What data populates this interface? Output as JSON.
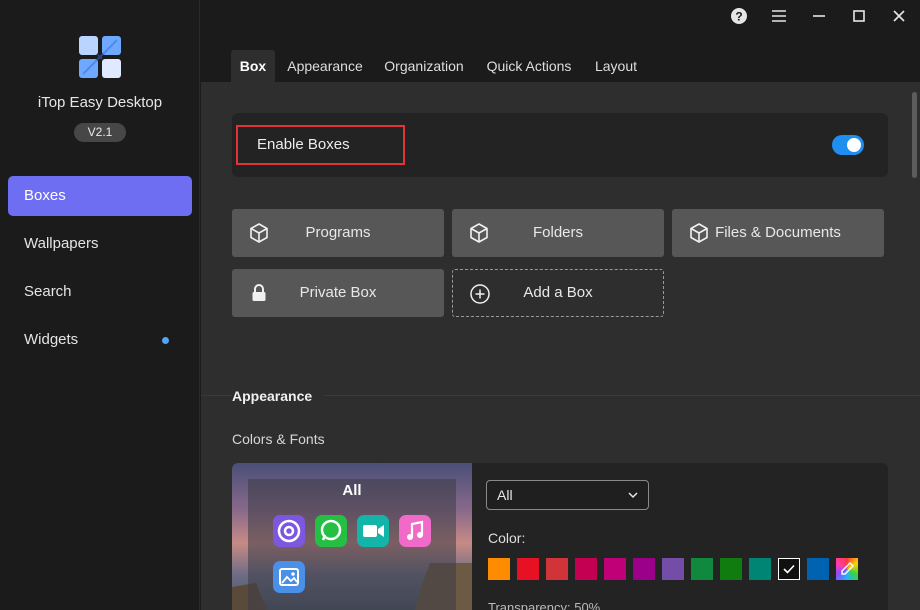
{
  "app": {
    "name": "iTop Easy Desktop",
    "version": "V2.1"
  },
  "sidebar": {
    "items": [
      {
        "label": "Boxes",
        "active": true
      },
      {
        "label": "Wallpapers",
        "active": false
      },
      {
        "label": "Search",
        "active": false
      },
      {
        "label": "Widgets",
        "active": false,
        "dot": true
      }
    ]
  },
  "window_controls": [
    "help-icon",
    "menu-icon",
    "minimize-icon",
    "maximize-icon",
    "close-icon"
  ],
  "tabs": [
    {
      "label": "Box",
      "active": true
    },
    {
      "label": "Appearance",
      "active": false
    },
    {
      "label": "Organization",
      "active": false
    },
    {
      "label": "Quick Actions",
      "active": false
    },
    {
      "label": "Layout",
      "active": false
    }
  ],
  "enable_boxes": {
    "label": "Enable Boxes",
    "enabled": true
  },
  "box_buttons": [
    {
      "label": "Programs",
      "icon": "cube-icon"
    },
    {
      "label": "Folders",
      "icon": "cube-icon"
    },
    {
      "label": "Files & Documents",
      "icon": "cube-icon"
    },
    {
      "label": "Private Box",
      "icon": "lock-icon"
    },
    {
      "label": "Add a Box",
      "icon": "plus-circle-icon"
    }
  ],
  "appearance": {
    "section_title": "Appearance",
    "subtitle": "Colors & Fonts",
    "preview_title": "All",
    "select_value": "All",
    "color_label": "Color:",
    "transparency_label": "Transparency: 50%",
    "swatches": [
      "#ff8c00",
      "#e81123",
      "#d13438",
      "#c30052",
      "#bf0077",
      "#9a0089",
      "#744da9",
      "#10893e",
      "#107c10",
      "#008575",
      "#111111",
      "#0063b1",
      "rainbow"
    ],
    "selected_swatch": 10
  },
  "colors": {
    "accent": "#6e6ef2",
    "toggle": "#1f8ef1",
    "highlight": "#e0333a"
  }
}
